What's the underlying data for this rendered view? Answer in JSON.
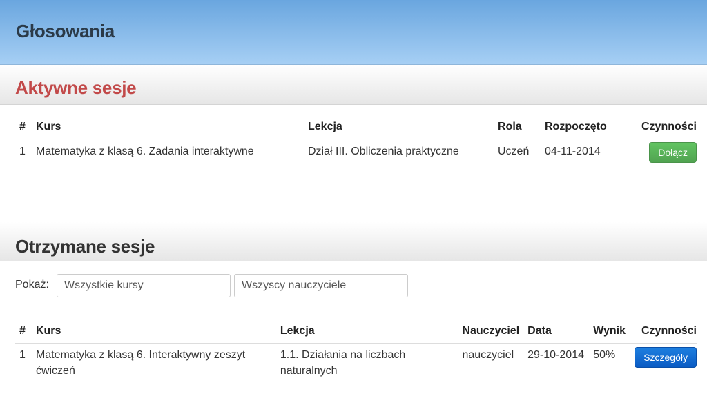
{
  "header": {
    "title": "Głosowania"
  },
  "active": {
    "title": "Aktywne sesje",
    "columns": [
      "#",
      "Kurs",
      "Lekcja",
      "Rola",
      "Rozpoczęto",
      "Czynności"
    ],
    "rows": [
      {
        "num": "1",
        "course": "Matematyka z klasą 6. Zadania interaktywne",
        "lesson": "Dział III. Obliczenia praktyczne",
        "role": "Uczeń",
        "started": "04-11-2014",
        "action": "Dołącz"
      }
    ]
  },
  "received": {
    "title": "Otrzymane sesje",
    "filter_label": "Pokaż:",
    "course_filter": "Wszystkie kursy",
    "teacher_filter": "Wszyscy nauczyciele",
    "columns": [
      "#",
      "Kurs",
      "Lekcja",
      "Nauczyciel",
      "Data",
      "Wynik",
      "Czynności"
    ],
    "rows": [
      {
        "num": "1",
        "course": "Matematyka z klasą 6. Interaktywny zeszyt ćwiczeń",
        "lesson": "1.1. Działania na liczbach naturalnych",
        "teacher": "nauczyciel",
        "date": "29-10-2014",
        "score": "50%",
        "action": "Szczegóły"
      }
    ]
  },
  "colors": {
    "active_title": "#c24a4a",
    "join_button": "#5cb85c",
    "details_button": "#0d6ad8",
    "header_bg": "#8fc0ee"
  }
}
